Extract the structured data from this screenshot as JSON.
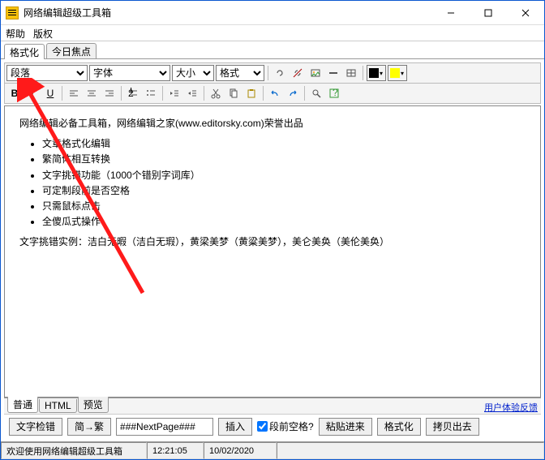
{
  "window": {
    "title": "网络编辑超级工具箱"
  },
  "menu": {
    "help": "帮助",
    "copyright": "版权"
  },
  "main_tabs": {
    "format": "格式化",
    "today": "今日焦点"
  },
  "toolbar": {
    "paragraph": "段落",
    "font": "字体",
    "size": "大小",
    "style": "格式",
    "bold": "B",
    "italic": "I",
    "underline": "U"
  },
  "colors": {
    "fg": "#000000",
    "bg": "#ffff00"
  },
  "editor": {
    "intro": "网络编辑必备工具箱，网络编辑之家(www.editorsky.com)荣誉出品",
    "features": [
      "文章格式化编辑",
      "繁简体相互转换",
      "文字挑错功能（1000个错别字词库）",
      "可定制段前是否空格",
      "只需鼠标点击",
      "全傻瓜式操作"
    ],
    "example": "文字挑错实例：洁白无暇（洁白无瑕），黄梁美梦（黄粱美梦），美仑美奂（美伦美奂）"
  },
  "bottom_tabs": {
    "normal": "普通",
    "html": "HTML",
    "preview": "预览"
  },
  "feedback_link": "用户体验反馈",
  "actions": {
    "check": "文字检错",
    "s2t": "简→繁",
    "nextpage_value": "###NextPage###",
    "insert": "插入",
    "space_before": "段前空格?",
    "paste_in": "粘贴进来",
    "format": "格式化",
    "copy_out": "拷贝出去"
  },
  "status": {
    "welcome": "欢迎使用网络编辑超级工具箱",
    "time": "12:21:05",
    "date": "10/02/2020"
  }
}
